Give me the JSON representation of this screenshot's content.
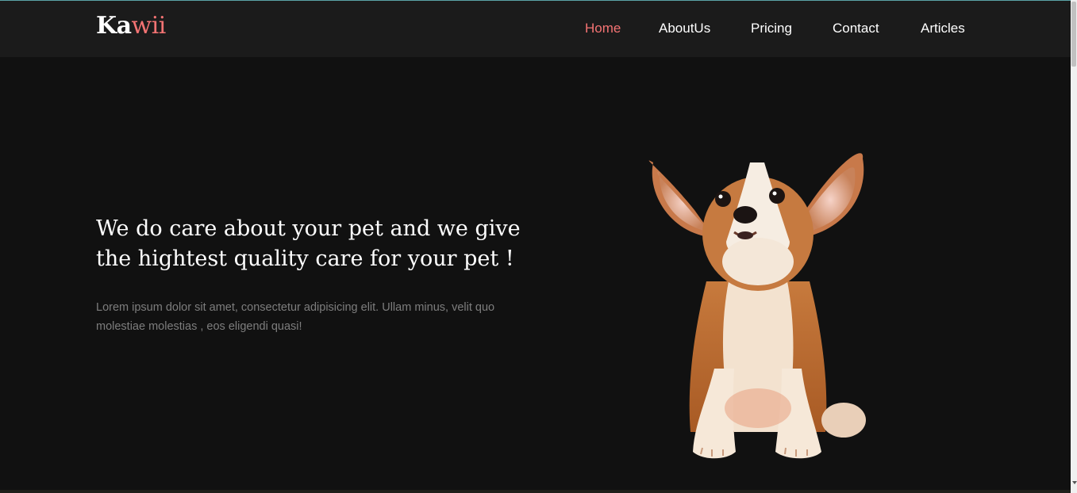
{
  "brand": {
    "logo_part_a": "Ka",
    "logo_part_b": "wii",
    "accent_color": "#f47373"
  },
  "nav": {
    "items": [
      {
        "label": "Home",
        "active": true
      },
      {
        "label": "AboutUs",
        "active": false
      },
      {
        "label": "Pricing",
        "active": false
      },
      {
        "label": "Contact",
        "active": false
      },
      {
        "label": "Articles",
        "active": false
      }
    ]
  },
  "hero": {
    "title": "We do care about your pet and we give the hightest quality care for your pet !",
    "text": "Lorem ipsum dolor sit amet, consectetur adipisicing elit. Ullam minus, velit quo molestiae molestias , eos eligendi quasi!",
    "image_icon": "corgi-puppy-image"
  },
  "colors": {
    "background": "#111111",
    "navbar": "#1b1b1b",
    "text_primary": "#ffffff",
    "text_muted": "#7d7d7d"
  }
}
